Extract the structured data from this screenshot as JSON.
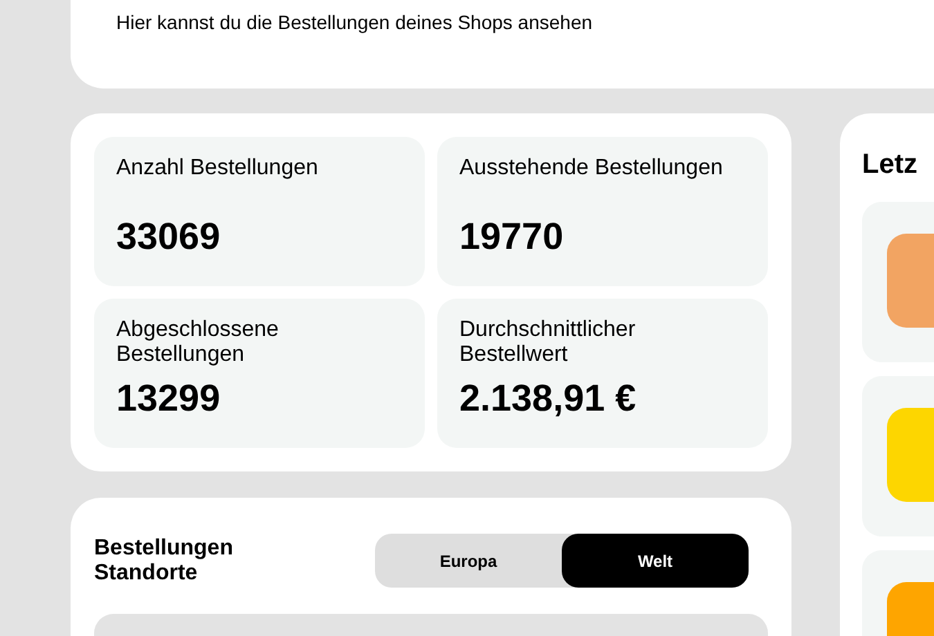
{
  "header": {
    "subtitle": "Hier kannst du die Bestellungen deines Shops ansehen"
  },
  "stats": [
    {
      "label": "Anzahl Bestellungen",
      "value": "33069"
    },
    {
      "label": "Ausstehende Bestellungen",
      "value": "19770"
    },
    {
      "label": "Abgeschlossene Bestellungen",
      "value": "13299"
    },
    {
      "label": "Durchschnittlicher Bestellwert",
      "value": "2.138,91 €"
    }
  ],
  "locations": {
    "title": "Bestellungen Standorte",
    "options": [
      {
        "label": "Europa",
        "selected": false
      },
      {
        "label": "Welt",
        "selected": true
      }
    ]
  },
  "recent": {
    "title": "Letz",
    "items": [
      {
        "color": "#f2a462"
      },
      {
        "color": "#fdd600"
      },
      {
        "color": "#fea500"
      }
    ]
  }
}
